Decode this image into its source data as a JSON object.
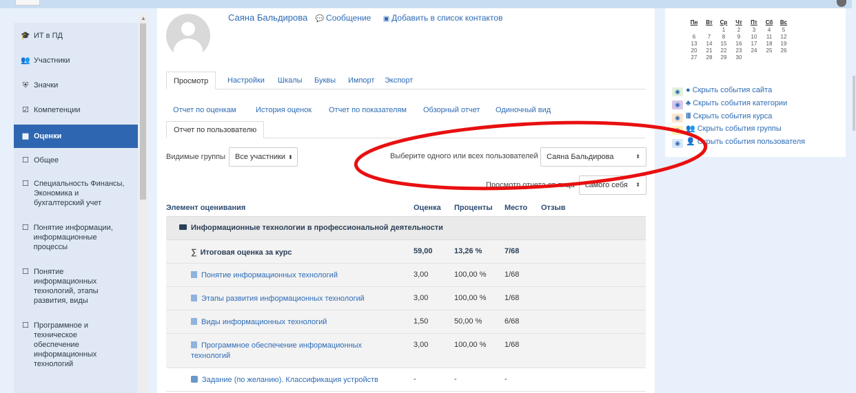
{
  "sidebar": {
    "items": [
      {
        "icon": "graduation-cap-icon",
        "glyph": "🎓",
        "label": "ИТ в ПД"
      },
      {
        "icon": "users-icon",
        "glyph": "👥",
        "label": "Участники"
      },
      {
        "icon": "shield-icon",
        "glyph": "⛨",
        "label": "Значки"
      },
      {
        "icon": "checkbox-icon",
        "glyph": "☑",
        "label": "Компетенции"
      },
      {
        "icon": "table-icon",
        "glyph": "▦",
        "label": "Оценки"
      },
      {
        "icon": "folder-icon",
        "glyph": "☐",
        "label": "Общее"
      },
      {
        "icon": "folder-icon",
        "glyph": "☐",
        "label": "Специальность Финансы, Экономика и бухгалтерский учет"
      },
      {
        "icon": "folder-icon",
        "glyph": "☐",
        "label": "Понятие информации, информационные процессы"
      },
      {
        "icon": "folder-icon",
        "glyph": "☐",
        "label": "Понятие информационных технологий, этапы развития, виды"
      },
      {
        "icon": "folder-icon",
        "glyph": "☐",
        "label": "Программное и техническое обеспечение информационных технологий"
      }
    ]
  },
  "profile": {
    "name": "Саяна Бальдирова",
    "message_label": "Сообщение",
    "contacts_label": "Добавить в список контактов"
  },
  "tabs_main": [
    "Просмотр",
    "Настройки",
    "Шкалы",
    "Буквы",
    "Импорт",
    "Экспорт"
  ],
  "tabs_reports": [
    "Отчет по оценкам",
    "История оценок",
    "Отчет по показателям",
    "Обзорный отчет",
    "Одиночный вид",
    "Отчет по пользователю"
  ],
  "filters": {
    "groups_label": "Видимые группы",
    "groups_value": "Все участники",
    "user_label": "Выберите одного или всех пользователей",
    "user_value": "Саяна Бальдирова",
    "view_as_label": "Просмотр отчета от лица",
    "view_as_value": "самого себя"
  },
  "grades_table": {
    "headers": {
      "item": "Элемент оценивания",
      "grade": "Оценка",
      "percent": "Проценты",
      "rank": "Место",
      "feedback": "Отзыв"
    },
    "category": "Информационные технологии в профессиональной деятельности",
    "total": {
      "name": "Итоговая оценка за курс",
      "grade": "59,00",
      "percent": "13,26 %",
      "rank": "7/68"
    },
    "rows": [
      {
        "name": "Понятие информационных технологий",
        "grade": "3,00",
        "percent": "100,00 %",
        "rank": "1/68"
      },
      {
        "name": "Этапы развития информационных технологий",
        "grade": "3,00",
        "percent": "100,00 %",
        "rank": "1/68"
      },
      {
        "name": "Виды информационных технологий",
        "grade": "1,50",
        "percent": "50,00 %",
        "rank": "6/68"
      },
      {
        "name": "Программное обеспечение информационных технологий",
        "grade": "3,00",
        "percent": "100,00 %",
        "rank": "1/68"
      },
      {
        "name": "Задание (по желанию). Классификация устройств",
        "grade": "-",
        "percent": "-",
        "rank": "-"
      }
    ]
  },
  "calendar": {
    "weekdays": [
      "Пн",
      "Вт",
      "Ср",
      "Чт",
      "Пт",
      "Сб",
      "Вс"
    ],
    "weeks": [
      [
        "",
        "",
        "1",
        "2",
        "3",
        "4",
        "5"
      ],
      [
        "6",
        "7",
        "8",
        "9",
        "10",
        "11",
        "12"
      ],
      [
        "13",
        "14",
        "15",
        "16",
        "17",
        "18",
        "19"
      ],
      [
        "20",
        "21",
        "22",
        "23",
        "24",
        "25",
        "26"
      ],
      [
        "27",
        "28",
        "29",
        "30",
        "",
        "",
        ""
      ]
    ]
  },
  "event_filters": [
    {
      "label": "Скрыть события сайта",
      "color": "#e3f1dd",
      "type_icon": "globe-icon",
      "glyph": "●"
    },
    {
      "label": "Скрыть события категории",
      "color": "#d7c7ea",
      "type_icon": "cubes-icon",
      "glyph": "♣"
    },
    {
      "label": "Скрыть события курса",
      "color": "#fde6cf",
      "type_icon": "institution-icon",
      "glyph": "🏛"
    },
    {
      "label": "Скрыть события группы",
      "color": "#fff1b8",
      "type_icon": "group-icon",
      "glyph": "👥"
    },
    {
      "label": "Скрыть события пользователя",
      "color": "#d8e8f7",
      "type_icon": "user-icon",
      "glyph": "👤"
    }
  ],
  "colors": {
    "accent": "#2f66b1",
    "annotation": "#e81010"
  }
}
